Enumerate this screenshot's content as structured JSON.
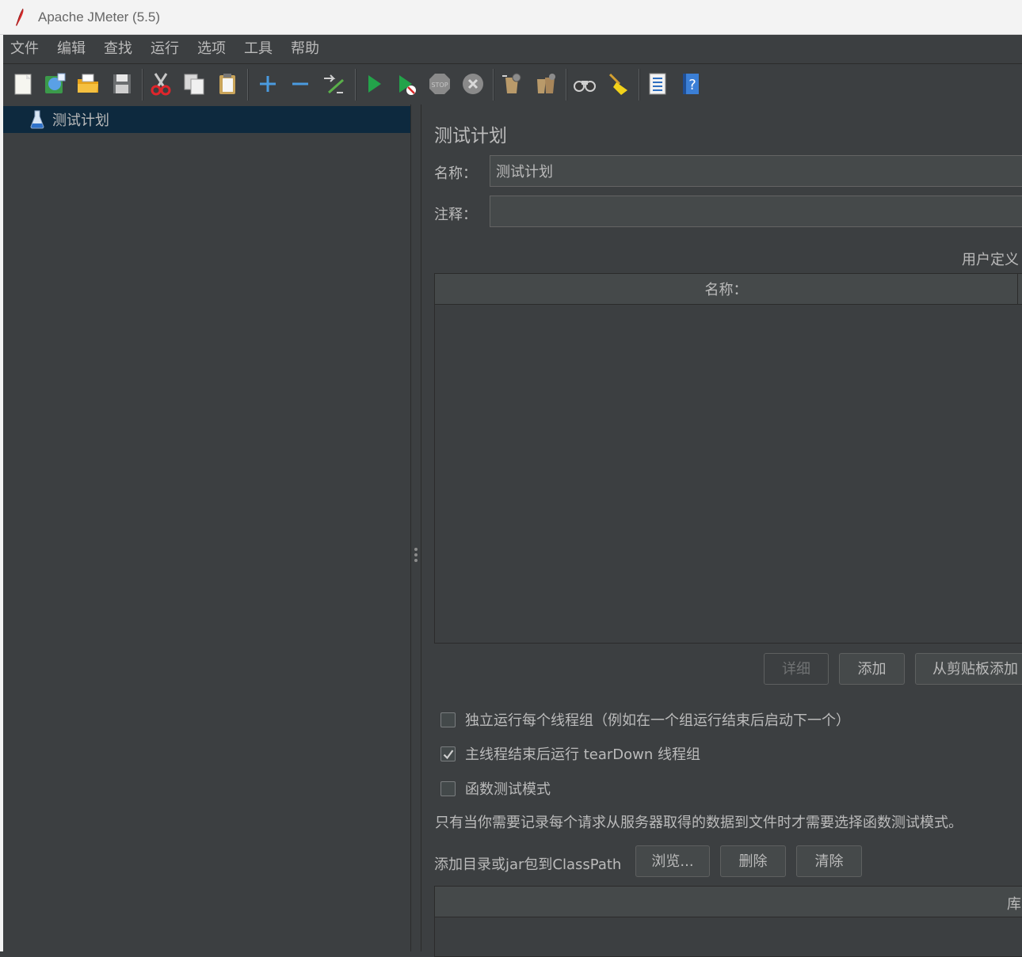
{
  "window": {
    "title": "Apache JMeter (5.5)"
  },
  "menu": [
    "文件",
    "编辑",
    "查找",
    "运行",
    "选项",
    "工具",
    "帮助"
  ],
  "toolbar": {
    "icons": [
      "new-icon",
      "templates-icon",
      "open-icon",
      "save-icon",
      "cut-icon",
      "copy-icon",
      "paste-icon",
      "expand-icon",
      "collapse-icon",
      "toggle-icon",
      "start-icon",
      "start-no-pause-icon",
      "stop-icon",
      "shutdown-icon",
      "clear-icon",
      "clear-all-icon",
      "search-icon",
      "reset-search-icon",
      "function-helper-icon",
      "help-icon"
    ]
  },
  "tree": {
    "root_label": "测试计划"
  },
  "panel": {
    "heading": "测试计划",
    "name_label": "名称：",
    "name_value": "测试计划",
    "comment_label": "注释：",
    "comment_value": "",
    "udv_title": "用户定义",
    "table_col_name": "名称：",
    "btn_detail": "详细",
    "btn_add": "添加",
    "btn_add_clipboard": "从剪贴板添加",
    "cb_serialize": "独立运行每个线程组（例如在一个组运行结束后启动下一个）",
    "cb_serialize_checked": false,
    "cb_teardown": "主线程结束后运行 tearDown 线程组",
    "cb_teardown_checked": true,
    "cb_functional": "函数测试模式",
    "cb_functional_checked": false,
    "functional_note": "只有当你需要记录每个请求从服务器取得的数据到文件时才需要选择函数测试模式。",
    "classpath_label": "添加目录或jar包到ClassPath",
    "btn_browse": "浏览...",
    "btn_delete": "删除",
    "btn_clear": "清除",
    "lib_col": "库"
  }
}
